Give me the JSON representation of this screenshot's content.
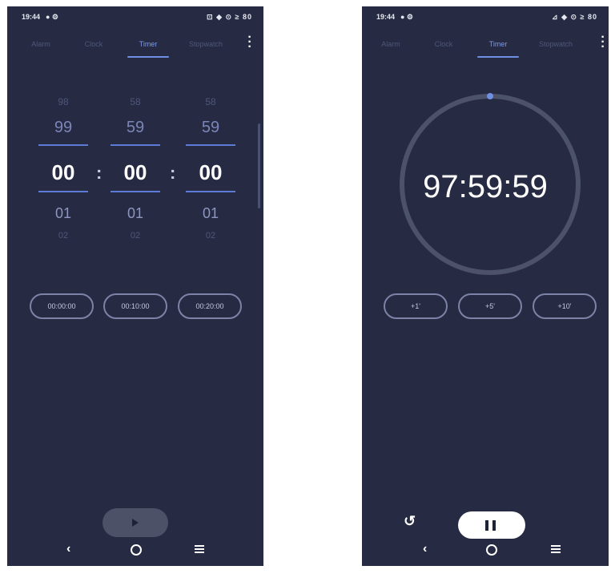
{
  "status_bar": {
    "time": "19:44",
    "left_icons": "● ⚙",
    "right_icons_left": "⊡ ◆ ⊙ ≥ 80",
    "right_icons_right": "⊿ ◆ ⊙ ≥ 80"
  },
  "tabs": [
    "Alarm",
    "Clock",
    "Timer",
    "Stopwatch"
  ],
  "active_tab": "Timer",
  "picker": {
    "hours": {
      "far_prev": "98",
      "prev": "99",
      "current": "00",
      "next": "01",
      "far_next": "02"
    },
    "minutes": {
      "far_prev": "58",
      "prev": "59",
      "current": "00",
      "next": "01",
      "far_next": "02"
    },
    "seconds": {
      "far_prev": "58",
      "prev": "59",
      "current": "00",
      "next": "01",
      "far_next": "02"
    },
    "separator": ":"
  },
  "presets": [
    "00:00:00",
    "00:10:00",
    "00:20:00"
  ],
  "running": {
    "time": "97:59:59",
    "progress": 0.0,
    "increments": [
      "+1'",
      "+5'",
      "+10'"
    ]
  },
  "colors": {
    "background": "#262a42",
    "accent": "#6f8fe3",
    "ring": "#4c5269"
  },
  "icons": {
    "play": "play-icon",
    "pause": "pause-icon",
    "reset": "reset-icon",
    "back": "back-icon",
    "home": "home-icon",
    "recents": "recents-icon",
    "more": "more-vertical-icon"
  }
}
